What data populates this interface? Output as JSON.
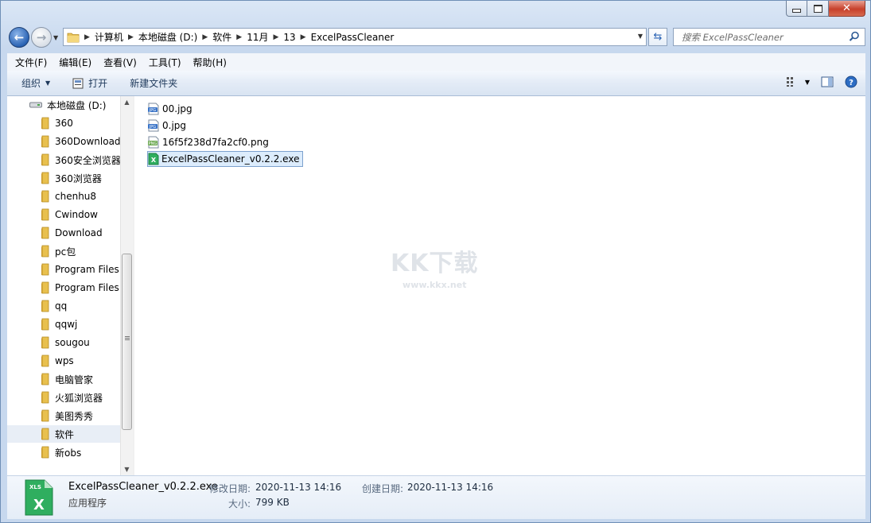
{
  "window": {
    "caption_buttons": [
      "minimize-icon",
      "maximize-icon",
      "close-icon"
    ]
  },
  "nav": {
    "breadcrumb": [
      "计算机",
      "本地磁盘 (D:)",
      "软件",
      "11月",
      "13",
      "ExcelPassCleaner"
    ],
    "search_placeholder": "搜索 ExcelPassCleaner"
  },
  "menu": [
    "文件(F)",
    "编辑(E)",
    "查看(V)",
    "工具(T)",
    "帮助(H)"
  ],
  "toolbar": {
    "organize": "组织",
    "open": "打开",
    "new_folder": "新建文件夹"
  },
  "tree": {
    "drive": "本地磁盘 (D:)",
    "folders": [
      "360",
      "360Download",
      "360安全浏览器",
      "360浏览器",
      "chenhu8",
      "Cwindow",
      "Download",
      "pc包",
      "Program Files",
      "Program Files",
      "qq",
      "qqwj",
      "sougou",
      "wps",
      "电脑管家",
      "火狐浏览器",
      "美图秀秀",
      "软件",
      "新obs"
    ],
    "selected": "软件"
  },
  "files": [
    {
      "name": "00.jpg",
      "icon": "jpg-file-icon"
    },
    {
      "name": "0.jpg",
      "icon": "jpg-file-icon"
    },
    {
      "name": "16f5f238d7fa2cf0.png",
      "icon": "png-file-icon"
    },
    {
      "name": "ExcelPassCleaner_v0.2.2.exe",
      "icon": "exe-file-icon",
      "selected": true
    }
  ],
  "watermark": {
    "brand": "KK下载",
    "url": "www.kkx.net"
  },
  "details": {
    "name": "ExcelPassCleaner_v0.2.2.exe",
    "type": "应用程序",
    "icon_text": "XLS",
    "modified_label": "修改日期:",
    "modified_value": "2020-11-13 14:16",
    "created_label": "创建日期:",
    "created_value": "2020-11-13 14:16",
    "size_label": "大小:",
    "size_value": "799 KB"
  }
}
